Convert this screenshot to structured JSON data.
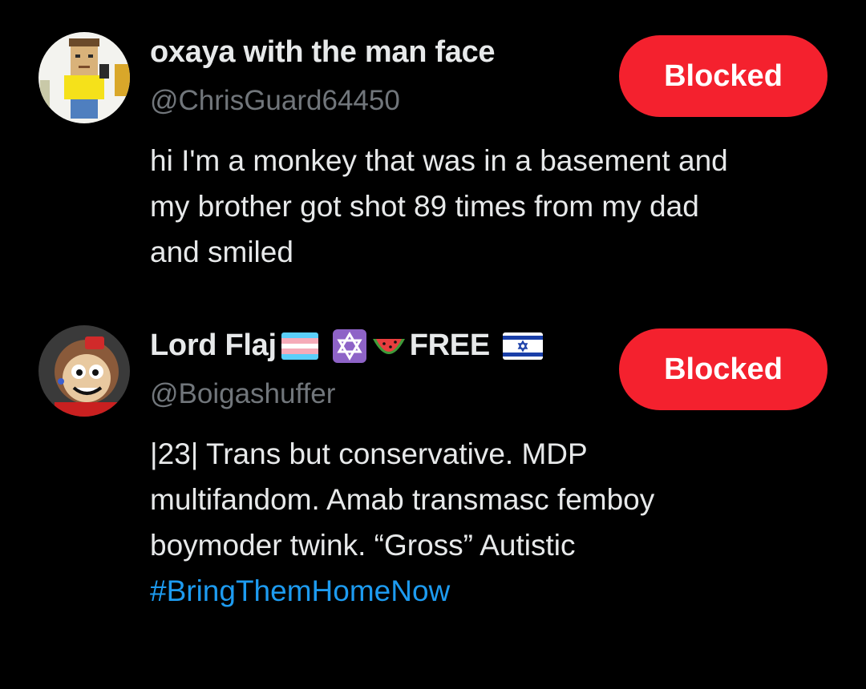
{
  "users": [
    {
      "display_name": "oxaya with the man face",
      "handle": "@ChrisGuard64450",
      "bio_lines": [
        "hi I'm a monkey that was in a basement and",
        "my brother got shot 89 times from my dad",
        "and smiled"
      ],
      "button_label": "Blocked"
    },
    {
      "display_name_text": "Lord Flaj",
      "display_name_emojis": [
        "transgender-flag-icon",
        "star-of-david-icon",
        "watermelon-icon"
      ],
      "display_name_suffix": "FREE",
      "display_name_flag": "israel-flag-icon",
      "handle": "@Boigashuffer",
      "bio_lines": [
        "|23| Trans but conservative. MDP",
        "multifandom. Amab transmasc femboy",
        "boymoder twink. “Gross” Autistic"
      ],
      "hashtag": "#BringThemHomeNow",
      "button_label": "Blocked"
    }
  ],
  "colors": {
    "background": "#000000",
    "primary_text": "#e7e9ea",
    "secondary_text": "#71767b",
    "blocked_red": "#f4212e",
    "hashtag_blue": "#1d9bf0"
  }
}
